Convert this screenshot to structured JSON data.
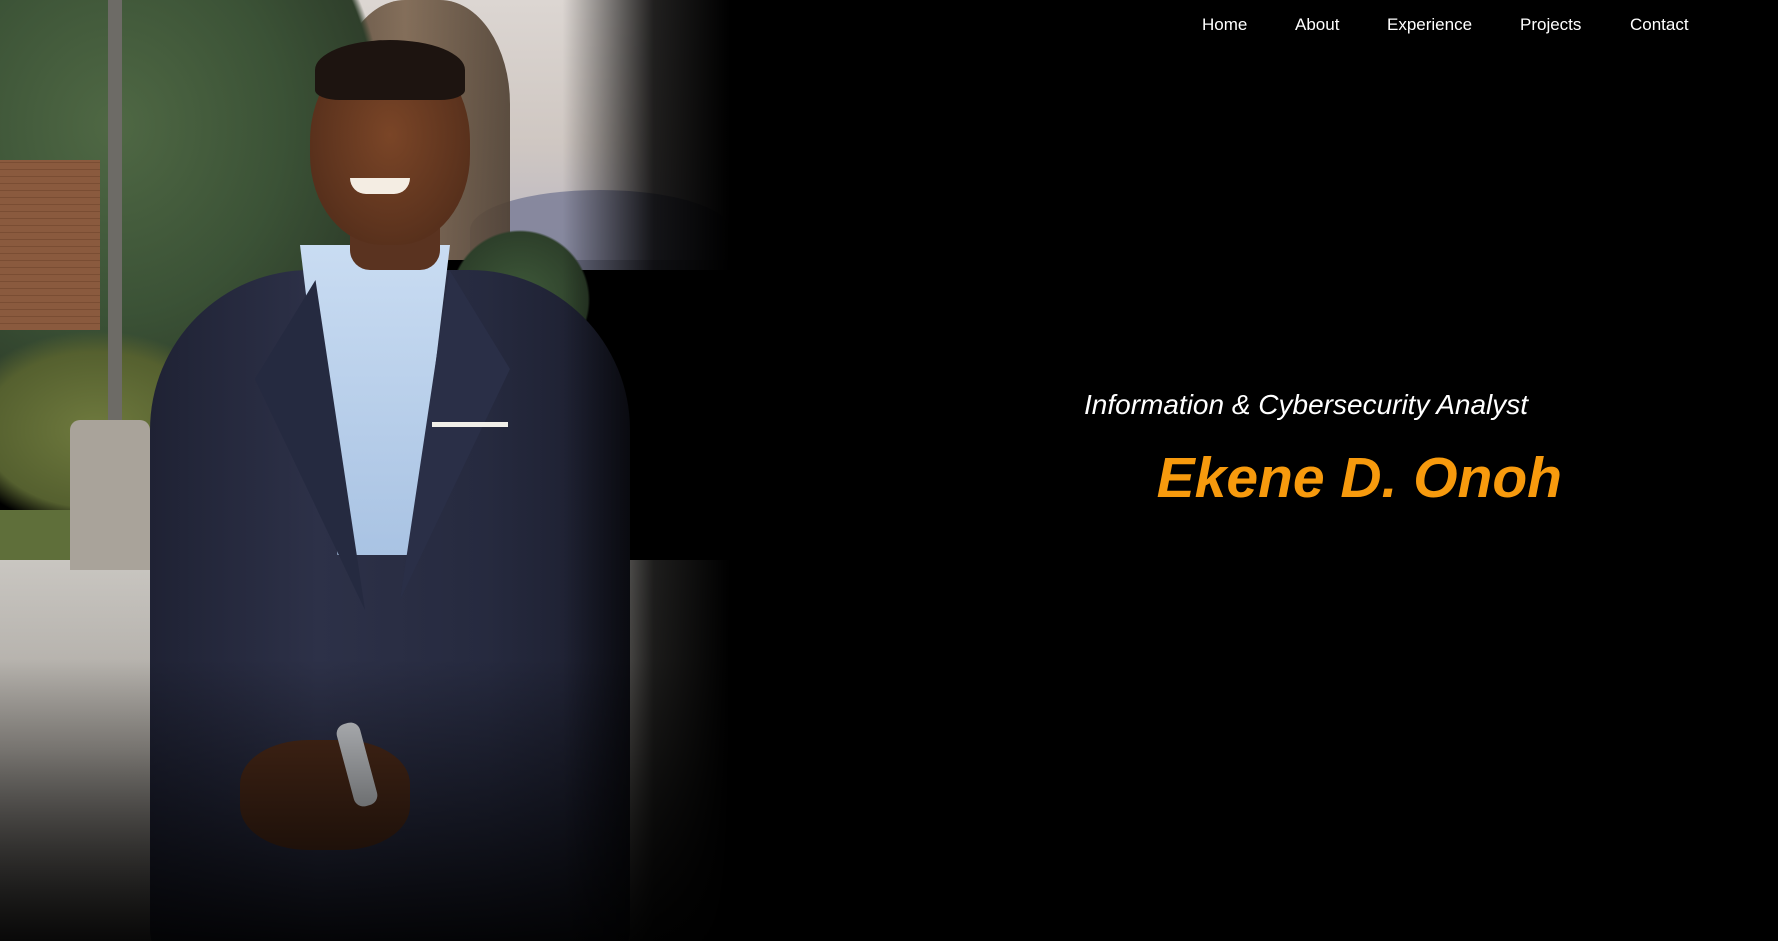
{
  "nav": {
    "items": [
      {
        "label": "Home"
      },
      {
        "label": "About"
      },
      {
        "label": "Experience"
      },
      {
        "label": "Projects"
      },
      {
        "label": "Contact"
      }
    ]
  },
  "hero": {
    "subtitle": "Information & Cybersecurity Analyst",
    "name": "Ekene D. Onoh",
    "photo_icon": "portrait-photo"
  },
  "colors": {
    "background": "#000000",
    "accent": "#f79a0d",
    "text": "#ffffff"
  }
}
